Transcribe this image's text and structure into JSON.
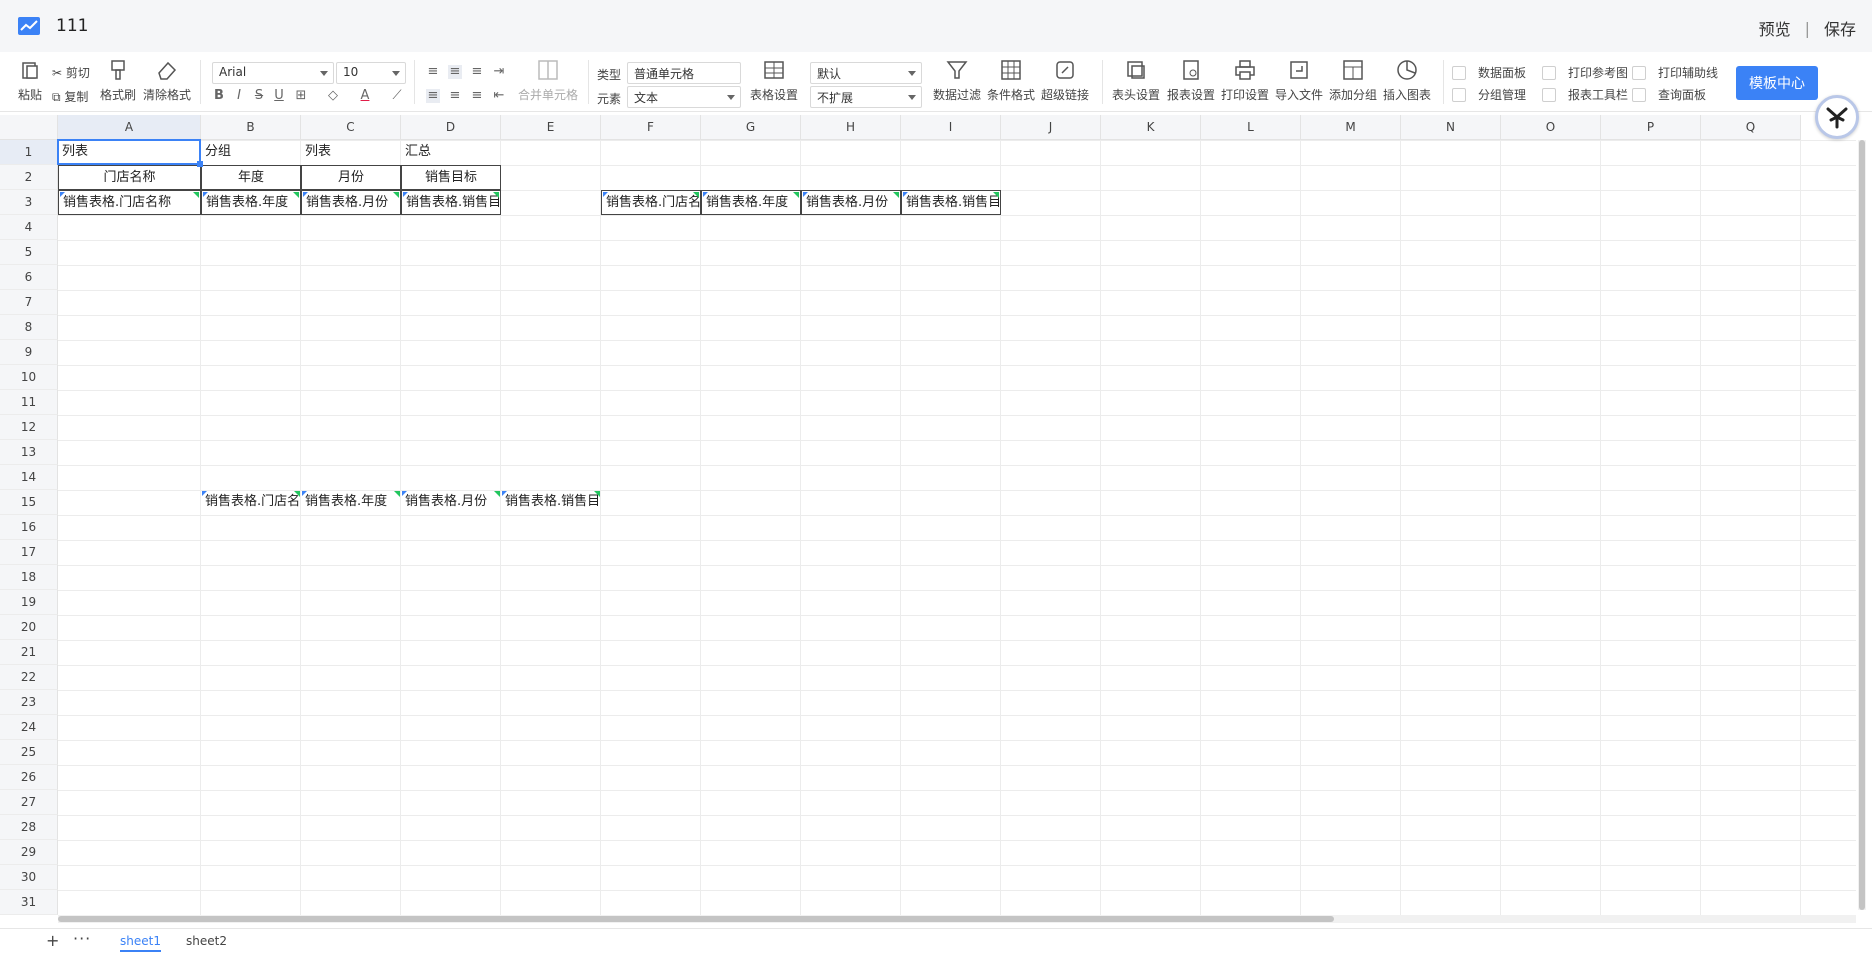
{
  "title_bar": {
    "doc_title": "111",
    "preview": "预览",
    "separator": "|",
    "save": "保存"
  },
  "toolbar": {
    "paste": "粘贴",
    "cut": "剪切",
    "copy": "复制",
    "format_painter": "格式刷",
    "clear_format": "清除格式",
    "font_family": "Arial",
    "font_size": "10",
    "merge_cells": "合并单元格",
    "type_label": "类型",
    "type_value": "普通单元格",
    "element_label": "元素",
    "element_value": "文本",
    "table_settings": "表格设置",
    "default_select": "默认",
    "expand_select": "不扩展",
    "data_filter": "数据过滤",
    "conditional_format": "条件格式",
    "hyperlink": "超级链接",
    "header_settings": "表头设置",
    "report_settings": "报表设置",
    "print_settings": "打印设置",
    "import_file": "导入文件",
    "add_group": "添加分组",
    "insert_chart": "插入图表",
    "checkboxes": {
      "data_panel": "数据面板",
      "group_manage": "分组管理",
      "print_ref": "打印参考图",
      "report_toolbar": "报表工具栏",
      "print_guides": "打印辅助线",
      "query_panel": "查询面板"
    },
    "template_center": "模板中心"
  },
  "grid": {
    "columns": [
      "A",
      "B",
      "C",
      "D",
      "E",
      "F",
      "G",
      "H",
      "I",
      "J",
      "K",
      "L",
      "M",
      "N",
      "O",
      "P",
      "Q"
    ],
    "rows": [
      "1",
      "2",
      "3",
      "4",
      "5",
      "6",
      "7",
      "8",
      "9",
      "10",
      "11",
      "12",
      "13",
      "14",
      "15",
      "16",
      "17",
      "18",
      "19",
      "20",
      "21",
      "22",
      "23",
      "24",
      "25",
      "26",
      "27",
      "28",
      "29",
      "30",
      "31"
    ],
    "cells": {
      "A1": "列表",
      "B1": "分组",
      "C1": "列表",
      "D1": "汇总",
      "A2": "门店名称",
      "B2": "年度",
      "C2": "月份",
      "D2": "销售目标",
      "A3": "销售表格.门店名称",
      "B3": "销售表格.年度",
      "C3": "销售表格.月份",
      "D3": "销售表格.销售目",
      "F3": "销售表格.门店名",
      "G3": "销售表格.年度",
      "H3": "销售表格.月份",
      "I3": "销售表格.销售目",
      "B15": "销售表格.门店名",
      "C15": "销售表格.年度",
      "D15": "销售表格.月份",
      "E15": "销售表格.销售目"
    }
  },
  "sheets": {
    "tabs": [
      "sheet1",
      "sheet2"
    ],
    "active": "sheet1"
  },
  "colors": {
    "accent": "#3b82f6",
    "marker_green": "#22c55e"
  }
}
